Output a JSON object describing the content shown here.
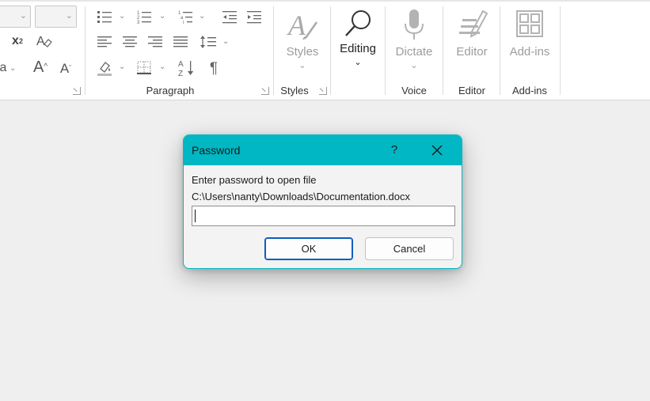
{
  "ribbon": {
    "groups": {
      "paragraph": "Paragraph",
      "styles": "Styles",
      "voice": "Voice",
      "editor": "Editor",
      "addins": "Add-ins"
    },
    "buttons": {
      "styles": "Styles",
      "editing": "Editing",
      "dictate": "Dictate",
      "editor": "Editor",
      "addins": "Add-ins"
    },
    "font_glyphs": {
      "superscript": "x",
      "superscript_mark": "2",
      "clear_format": "A",
      "grow_font": "A",
      "shrink_font": "A",
      "partial_letter": "a",
      "pilcrow": "¶"
    },
    "icons": [
      "bullets-icon",
      "numbering-icon",
      "multilevel-list-icon",
      "decrease-indent-icon",
      "increase-indent-icon",
      "align-left-icon",
      "align-center-icon",
      "align-right-icon",
      "justify-icon",
      "line-spacing-icon",
      "shading-icon",
      "borders-icon",
      "sort-icon",
      "pilcrow-icon",
      "styles-icon",
      "search-icon",
      "microphone-icon",
      "editor-pen-icon",
      "addins-grid-icon"
    ]
  },
  "dialog": {
    "title": "Password",
    "help": "?",
    "prompt": "Enter password to open file",
    "path": "C:\\Users\\nanty\\Downloads\\Documentation.docx",
    "password_value": "",
    "ok_label": "OK",
    "cancel_label": "Cancel",
    "accent": "#00b7c3"
  }
}
